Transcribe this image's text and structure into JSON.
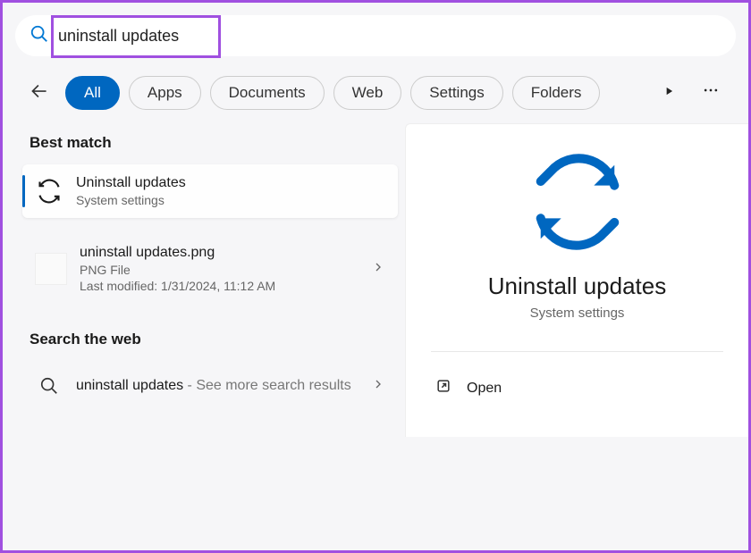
{
  "search": {
    "query": "uninstall updates"
  },
  "filters": {
    "items": [
      {
        "label": "All",
        "active": true
      },
      {
        "label": "Apps",
        "active": false
      },
      {
        "label": "Documents",
        "active": false
      },
      {
        "label": "Web",
        "active": false
      },
      {
        "label": "Settings",
        "active": false
      },
      {
        "label": "Folders",
        "active": false
      }
    ]
  },
  "sections": {
    "best_match": "Best match",
    "search_web": "Search the web"
  },
  "results": {
    "best": {
      "title": "Uninstall updates",
      "subtitle": "System settings"
    },
    "file": {
      "title": "uninstall updates.png",
      "subtitle": "PNG File",
      "modified": "Last modified: 1/31/2024, 11:12 AM"
    },
    "web": {
      "title": "uninstall updates",
      "suffix": " - See more search results"
    }
  },
  "detail": {
    "title": "Uninstall updates",
    "subtitle": "System settings",
    "action_open": "Open"
  },
  "colors": {
    "accent": "#0067c0",
    "highlight": "#a050e0"
  }
}
